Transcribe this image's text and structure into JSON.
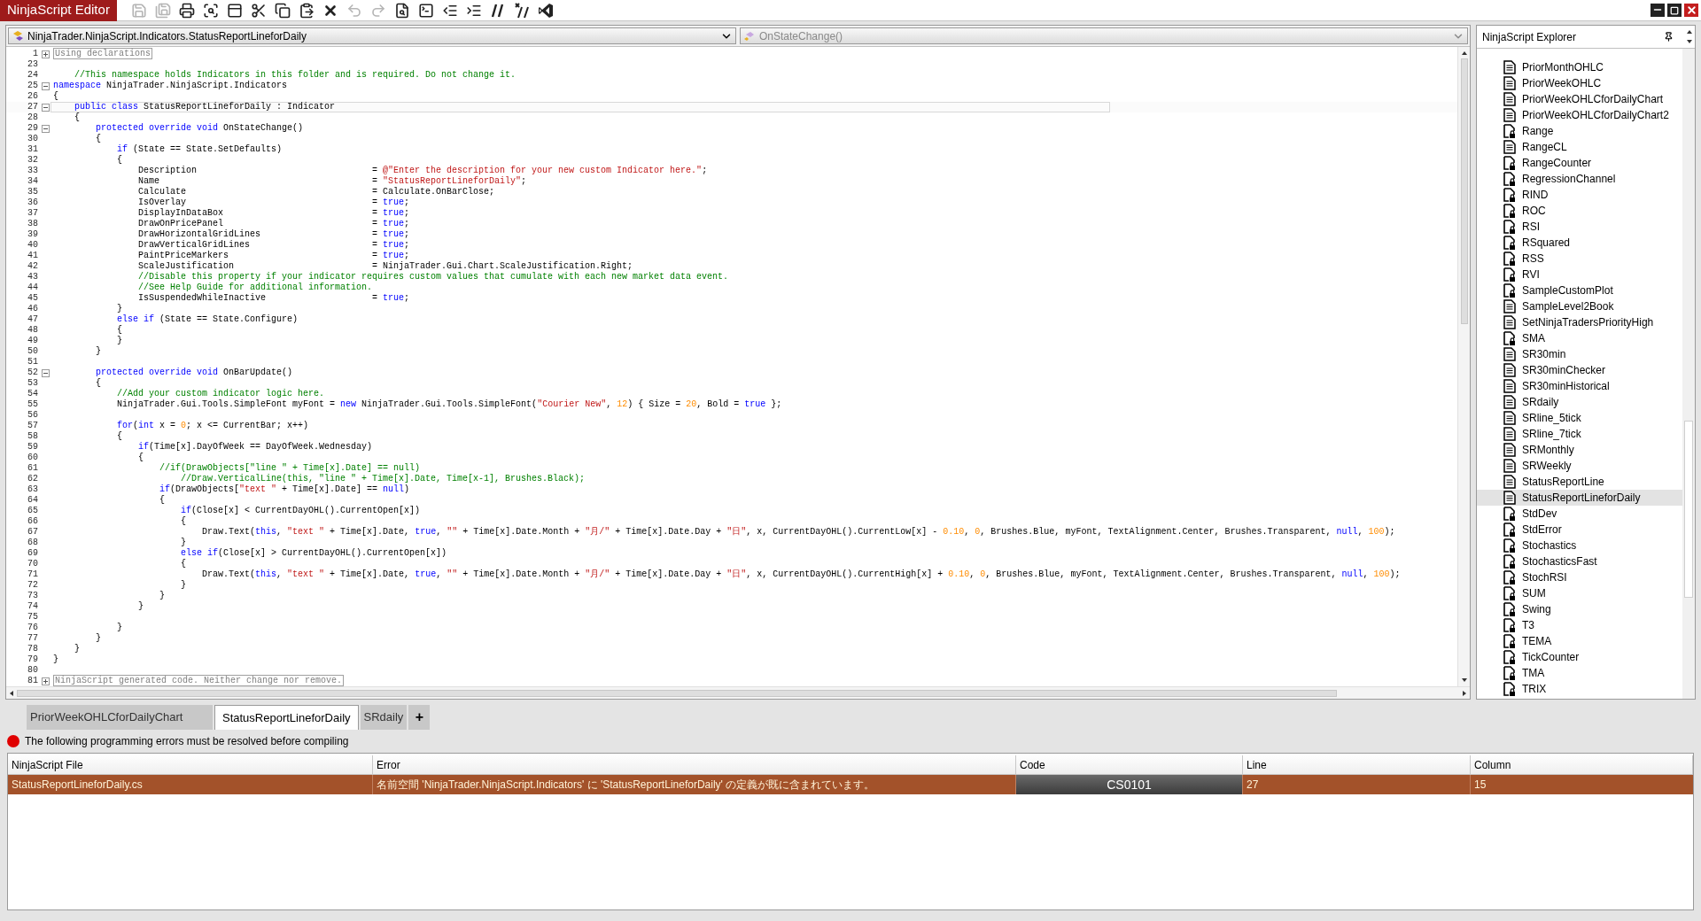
{
  "window": {
    "title": "NinjaScript Editor"
  },
  "toolbar": [
    {
      "kind": "save",
      "disabled": true
    },
    {
      "kind": "saveall",
      "disabled": true
    },
    {
      "kind": "print",
      "disabled": false
    },
    {
      "kind": "preview",
      "disabled": false
    },
    {
      "kind": "properties",
      "disabled": false
    },
    {
      "kind": "cut",
      "disabled": false
    },
    {
      "kind": "copy",
      "disabled": false
    },
    {
      "kind": "paste",
      "disabled": false
    },
    {
      "kind": "delete",
      "disabled": false
    },
    {
      "kind": "undo",
      "disabled": true
    },
    {
      "kind": "redo",
      "disabled": true
    },
    {
      "kind": "find",
      "disabled": false
    },
    {
      "kind": "compile",
      "disabled": false
    },
    {
      "kind": "outdent",
      "disabled": false
    },
    {
      "kind": "indent",
      "disabled": false
    },
    {
      "kind": "comment",
      "disabled": false
    },
    {
      "kind": "uncomment",
      "disabled": false
    },
    {
      "kind": "studio",
      "disabled": false
    }
  ],
  "editor": {
    "class_dropdown": "NinjaTrader.NinjaScript.Indicators.StatusReportLineforDaily",
    "member_dropdown": {
      "text": "OnStateChange()",
      "disabled": true
    },
    "lines": [
      {
        "num": "1",
        "collapsed": true,
        "current": false,
        "tokens": [
          {
            "kind": "region",
            "text": "Using declarations"
          }
        ]
      },
      {
        "num": "23",
        "current": false
      },
      {
        "num": "24",
        "current": false,
        "tokens": [
          {
            "kind": "comment",
            "text": "    //This namespace holds Indicators in this folder and is required. Do not change it."
          }
        ]
      },
      {
        "num": "25",
        "collapsed": false,
        "current": false,
        "tokens": [
          {
            "kind": "keyword",
            "text": "namespace"
          },
          {
            "kind": "plain",
            "text": " NinjaTrader.NinjaScript.Indicators"
          }
        ]
      },
      {
        "num": "26",
        "current": false,
        "tokens": [
          {
            "kind": "plain",
            "text": "{"
          }
        ]
      },
      {
        "num": "27",
        "collapsed": false,
        "current": true,
        "tokens": [
          {
            "kind": "keyword",
            "text": "    public class"
          },
          {
            "kind": "plain",
            "text": " StatusReportLineforDaily : Indicator"
          }
        ]
      },
      {
        "num": "28",
        "current": false,
        "tokens": [
          {
            "kind": "plain",
            "text": "    {"
          }
        ]
      },
      {
        "num": "29",
        "collapsed": false,
        "current": false,
        "tokens": [
          {
            "kind": "keyword",
            "text": "        protected override void"
          },
          {
            "kind": "plain",
            "text": " OnStateChange()"
          }
        ]
      },
      {
        "num": "30",
        "current": false,
        "tokens": [
          {
            "kind": "plain",
            "text": "        {"
          }
        ]
      },
      {
        "num": "31",
        "current": false,
        "tokens": [
          {
            "kind": "keyword",
            "text": "            if"
          },
          {
            "kind": "plain",
            "text": " (State == State.SetDefaults)"
          }
        ]
      },
      {
        "num": "32",
        "current": false,
        "tokens": [
          {
            "kind": "plain",
            "text": "            {"
          }
        ]
      },
      {
        "num": "33",
        "current": false,
        "tokens": [
          {
            "kind": "plain",
            "text": "                Description                                 = "
          },
          {
            "kind": "string",
            "text": "@\"Enter the description for your new custom Indicator here.\""
          },
          {
            "kind": "plain",
            "text": ";"
          }
        ]
      },
      {
        "num": "34",
        "current": false,
        "tokens": [
          {
            "kind": "plain",
            "text": "                Name                                        = "
          },
          {
            "kind": "string",
            "text": "\"StatusReportLineforDaily\""
          },
          {
            "kind": "plain",
            "text": ";"
          }
        ]
      },
      {
        "num": "35",
        "current": false,
        "tokens": [
          {
            "kind": "plain",
            "text": "                Calculate                                   = Calculate.OnBarClose;"
          }
        ]
      },
      {
        "num": "36",
        "current": false,
        "tokens": [
          {
            "kind": "plain",
            "text": "                IsOverlay                                   = "
          },
          {
            "kind": "keyword",
            "text": "true"
          },
          {
            "kind": "plain",
            "text": ";"
          }
        ]
      },
      {
        "num": "37",
        "current": false,
        "tokens": [
          {
            "kind": "plain",
            "text": "                DisplayInDataBox                            = "
          },
          {
            "kind": "keyword",
            "text": "true"
          },
          {
            "kind": "plain",
            "text": ";"
          }
        ]
      },
      {
        "num": "38",
        "current": false,
        "tokens": [
          {
            "kind": "plain",
            "text": "                DrawOnPricePanel                            = "
          },
          {
            "kind": "keyword",
            "text": "true"
          },
          {
            "kind": "plain",
            "text": ";"
          }
        ]
      },
      {
        "num": "39",
        "current": false,
        "tokens": [
          {
            "kind": "plain",
            "text": "                DrawHorizontalGridLines                     = "
          },
          {
            "kind": "keyword",
            "text": "true"
          },
          {
            "kind": "plain",
            "text": ";"
          }
        ]
      },
      {
        "num": "40",
        "current": false,
        "tokens": [
          {
            "kind": "plain",
            "text": "                DrawVerticalGridLines                       = "
          },
          {
            "kind": "keyword",
            "text": "true"
          },
          {
            "kind": "plain",
            "text": ";"
          }
        ]
      },
      {
        "num": "41",
        "current": false,
        "tokens": [
          {
            "kind": "plain",
            "text": "                PaintPriceMarkers                           = "
          },
          {
            "kind": "keyword",
            "text": "true"
          },
          {
            "kind": "plain",
            "text": ";"
          }
        ]
      },
      {
        "num": "42",
        "current": false,
        "tokens": [
          {
            "kind": "plain",
            "text": "                ScaleJustification                          = NinjaTrader.Gui.Chart.ScaleJustification.Right;"
          }
        ]
      },
      {
        "num": "43",
        "current": false,
        "tokens": [
          {
            "kind": "comment",
            "text": "                //Disable this property if your indicator requires custom values that cumulate with each new market data event."
          }
        ]
      },
      {
        "num": "44",
        "current": false,
        "tokens": [
          {
            "kind": "comment",
            "text": "                //See Help Guide for additional information."
          }
        ]
      },
      {
        "num": "45",
        "current": false,
        "tokens": [
          {
            "kind": "plain",
            "text": "                IsSuspendedWhileInactive                    = "
          },
          {
            "kind": "keyword",
            "text": "true"
          },
          {
            "kind": "plain",
            "text": ";"
          }
        ]
      },
      {
        "num": "46",
        "current": false,
        "tokens": [
          {
            "kind": "plain",
            "text": "            }"
          }
        ]
      },
      {
        "num": "47",
        "current": false,
        "tokens": [
          {
            "kind": "keyword",
            "text": "            else if"
          },
          {
            "kind": "plain",
            "text": " (State == State.Configure)"
          }
        ]
      },
      {
        "num": "48",
        "current": false,
        "tokens": [
          {
            "kind": "plain",
            "text": "            {"
          }
        ]
      },
      {
        "num": "49",
        "current": false,
        "tokens": [
          {
            "kind": "plain",
            "text": "            }"
          }
        ]
      },
      {
        "num": "50",
        "current": false,
        "tokens": [
          {
            "kind": "plain",
            "text": "        }"
          }
        ]
      },
      {
        "num": "51",
        "current": false
      },
      {
        "num": "52",
        "collapsed": false,
        "current": false,
        "tokens": [
          {
            "kind": "keyword",
            "text": "        protected override void"
          },
          {
            "kind": "plain",
            "text": " OnBarUpdate()"
          }
        ]
      },
      {
        "num": "53",
        "current": false,
        "tokens": [
          {
            "kind": "plain",
            "text": "        {"
          }
        ]
      },
      {
        "num": "54",
        "current": false,
        "tokens": [
          {
            "kind": "comment",
            "text": "            //Add your custom indicator logic here."
          }
        ]
      },
      {
        "num": "55",
        "current": false,
        "tokens": [
          {
            "kind": "plain",
            "text": "            NinjaTrader.Gui.Tools.SimpleFont myFont = "
          },
          {
            "kind": "keyword",
            "text": "new"
          },
          {
            "kind": "plain",
            "text": " NinjaTrader.Gui.Tools.SimpleFont("
          },
          {
            "kind": "string",
            "text": "\"Courier New\""
          },
          {
            "kind": "plain",
            "text": ", "
          },
          {
            "kind": "number",
            "text": "12"
          },
          {
            "kind": "plain",
            "text": ") { Size = "
          },
          {
            "kind": "number",
            "text": "20"
          },
          {
            "kind": "plain",
            "text": ", Bold = "
          },
          {
            "kind": "keyword",
            "text": "true"
          },
          {
            "kind": "plain",
            "text": " };"
          }
        ]
      },
      {
        "num": "56",
        "current": false
      },
      {
        "num": "57",
        "current": false,
        "tokens": [
          {
            "kind": "keyword",
            "text": "            for"
          },
          {
            "kind": "plain",
            "text": "("
          },
          {
            "kind": "keyword",
            "text": "int"
          },
          {
            "kind": "plain",
            "text": " x = "
          },
          {
            "kind": "number",
            "text": "0"
          },
          {
            "kind": "plain",
            "text": "; x <= CurrentBar; x++)"
          }
        ]
      },
      {
        "num": "58",
        "current": false,
        "tokens": [
          {
            "kind": "plain",
            "text": "            {"
          }
        ]
      },
      {
        "num": "59",
        "current": false,
        "tokens": [
          {
            "kind": "keyword",
            "text": "                if"
          },
          {
            "kind": "plain",
            "text": "(Time[x].DayOfWeek == DayOfWeek.Wednesday)"
          }
        ]
      },
      {
        "num": "60",
        "current": false,
        "tokens": [
          {
            "kind": "plain",
            "text": "                {"
          }
        ]
      },
      {
        "num": "61",
        "current": false,
        "tokens": [
          {
            "kind": "comment",
            "text": "                    //if(DrawObjects[\"line \" + Time[x].Date] == null)"
          }
        ]
      },
      {
        "num": "62",
        "current": false,
        "tokens": [
          {
            "kind": "comment",
            "text": "                        //Draw.VerticalLine(this, \"line \" + Time[x].Date, Time[x-1], Brushes.Black);"
          }
        ]
      },
      {
        "num": "63",
        "current": false,
        "tokens": [
          {
            "kind": "keyword",
            "text": "                    if"
          },
          {
            "kind": "plain",
            "text": "(DrawObjects["
          },
          {
            "kind": "string",
            "text": "\"text \""
          },
          {
            "kind": "plain",
            "text": " + Time[x].Date] == "
          },
          {
            "kind": "keyword",
            "text": "null"
          },
          {
            "kind": "plain",
            "text": ")"
          }
        ]
      },
      {
        "num": "64",
        "current": false,
        "tokens": [
          {
            "kind": "plain",
            "text": "                    {"
          }
        ]
      },
      {
        "num": "65",
        "current": false,
        "tokens": [
          {
            "kind": "keyword",
            "text": "                        if"
          },
          {
            "kind": "plain",
            "text": "(Close[x] < CurrentDayOHL().CurrentOpen[x])"
          }
        ]
      },
      {
        "num": "66",
        "current": false,
        "tokens": [
          {
            "kind": "plain",
            "text": "                        {"
          }
        ]
      },
      {
        "num": "67",
        "current": false,
        "tokens": [
          {
            "kind": "plain",
            "text": "                            Draw.Text("
          },
          {
            "kind": "keyword",
            "text": "this"
          },
          {
            "kind": "plain",
            "text": ", "
          },
          {
            "kind": "string",
            "text": "\"text \""
          },
          {
            "kind": "plain",
            "text": " + Time[x].Date, "
          },
          {
            "kind": "keyword",
            "text": "true"
          },
          {
            "kind": "plain",
            "text": ", "
          },
          {
            "kind": "string",
            "text": "\"\""
          },
          {
            "kind": "plain",
            "text": " + Time[x].Date.Month + "
          },
          {
            "kind": "string",
            "text": "\"月/\""
          },
          {
            "kind": "plain",
            "text": " + Time[x].Date.Day + "
          },
          {
            "kind": "string",
            "text": "\"日\""
          },
          {
            "kind": "plain",
            "text": ", x, CurrentDayOHL().CurrentLow[x] - "
          },
          {
            "kind": "number",
            "text": "0.10"
          },
          {
            "kind": "plain",
            "text": ", "
          },
          {
            "kind": "number",
            "text": "0"
          },
          {
            "kind": "plain",
            "text": ", Brushes.Blue, myFont, TextAlignment.Center, Brushes.Transparent, "
          },
          {
            "kind": "keyword",
            "text": "null"
          },
          {
            "kind": "plain",
            "text": ", "
          },
          {
            "kind": "number",
            "text": "100"
          },
          {
            "kind": "plain",
            "text": ");"
          }
        ]
      },
      {
        "num": "68",
        "current": false,
        "tokens": [
          {
            "kind": "plain",
            "text": "                        }"
          }
        ]
      },
      {
        "num": "69",
        "current": false,
        "tokens": [
          {
            "kind": "keyword",
            "text": "                        else if"
          },
          {
            "kind": "plain",
            "text": "(Close[x] > CurrentDayOHL().CurrentOpen[x])"
          }
        ]
      },
      {
        "num": "70",
        "current": false,
        "tokens": [
          {
            "kind": "plain",
            "text": "                        {"
          }
        ]
      },
      {
        "num": "71",
        "current": false,
        "tokens": [
          {
            "kind": "plain",
            "text": "                            Draw.Text("
          },
          {
            "kind": "keyword",
            "text": "this"
          },
          {
            "kind": "plain",
            "text": ", "
          },
          {
            "kind": "string",
            "text": "\"text \""
          },
          {
            "kind": "plain",
            "text": " + Time[x].Date, "
          },
          {
            "kind": "keyword",
            "text": "true"
          },
          {
            "kind": "plain",
            "text": ", "
          },
          {
            "kind": "string",
            "text": "\"\""
          },
          {
            "kind": "plain",
            "text": " + Time[x].Date.Month + "
          },
          {
            "kind": "string",
            "text": "\"月/\""
          },
          {
            "kind": "plain",
            "text": " + Time[x].Date.Day + "
          },
          {
            "kind": "string",
            "text": "\"日\""
          },
          {
            "kind": "plain",
            "text": ", x, CurrentDayOHL().CurrentHigh[x] + "
          },
          {
            "kind": "number",
            "text": "0.10"
          },
          {
            "kind": "plain",
            "text": ", "
          },
          {
            "kind": "number",
            "text": "0"
          },
          {
            "kind": "plain",
            "text": ", Brushes.Blue, myFont, TextAlignment.Center, Brushes.Transparent, "
          },
          {
            "kind": "keyword",
            "text": "null"
          },
          {
            "kind": "plain",
            "text": ", "
          },
          {
            "kind": "number",
            "text": "100"
          },
          {
            "kind": "plain",
            "text": ");"
          }
        ]
      },
      {
        "num": "72",
        "current": false,
        "tokens": [
          {
            "kind": "plain",
            "text": "                        }"
          }
        ]
      },
      {
        "num": "73",
        "current": false,
        "tokens": [
          {
            "kind": "plain",
            "text": "                    }"
          }
        ]
      },
      {
        "num": "74",
        "current": false,
        "tokens": [
          {
            "kind": "plain",
            "text": "                }"
          }
        ]
      },
      {
        "num": "75",
        "current": false
      },
      {
        "num": "76",
        "current": false,
        "tokens": [
          {
            "kind": "plain",
            "text": "            }"
          }
        ]
      },
      {
        "num": "77",
        "current": false,
        "tokens": [
          {
            "kind": "plain",
            "text": "        }"
          }
        ]
      },
      {
        "num": "78",
        "current": false,
        "tokens": [
          {
            "kind": "plain",
            "text": "    }"
          }
        ]
      },
      {
        "num": "79",
        "current": false,
        "tokens": [
          {
            "kind": "plain",
            "text": "}"
          }
        ]
      },
      {
        "num": "80",
        "current": false
      },
      {
        "num": "81",
        "collapsed": true,
        "current": false,
        "tokens": [
          {
            "kind": "region",
            "text": "NinjaScript generated code. Neither change nor remove."
          }
        ]
      }
    ]
  },
  "explorer": {
    "title": "NinjaScript Explorer",
    "items": [
      {
        "text": "PriorMonthOHLC",
        "kind": "file",
        "selected": false
      },
      {
        "text": "PriorWeekOHLC",
        "kind": "file",
        "selected": false
      },
      {
        "text": "PriorWeekOHLCforDailyChart",
        "kind": "file",
        "selected": false
      },
      {
        "text": "PriorWeekOHLCforDailyChart2",
        "kind": "file",
        "selected": false
      },
      {
        "text": "Range",
        "kind": "locked",
        "selected": false
      },
      {
        "text": "RangeCL",
        "kind": "file",
        "selected": false
      },
      {
        "text": "RangeCounter",
        "kind": "locked",
        "selected": false
      },
      {
        "text": "RegressionChannel",
        "kind": "locked",
        "selected": false
      },
      {
        "text": "RIND",
        "kind": "locked",
        "selected": false
      },
      {
        "text": "ROC",
        "kind": "locked",
        "selected": false
      },
      {
        "text": "RSI",
        "kind": "locked",
        "selected": false
      },
      {
        "text": "RSquared",
        "kind": "locked",
        "selected": false
      },
      {
        "text": "RSS",
        "kind": "locked",
        "selected": false
      },
      {
        "text": "RVI",
        "kind": "locked",
        "selected": false
      },
      {
        "text": "SampleCustomPlot",
        "kind": "locked",
        "selected": false
      },
      {
        "text": "SampleLevel2Book",
        "kind": "file",
        "selected": false
      },
      {
        "text": "SetNinjaTradersPriorityHigh",
        "kind": "file",
        "selected": false
      },
      {
        "text": "SMA",
        "kind": "locked",
        "selected": false
      },
      {
        "text": "SR30min",
        "kind": "file",
        "selected": false
      },
      {
        "text": "SR30minChecker",
        "kind": "file",
        "selected": false
      },
      {
        "text": "SR30minHistorical",
        "kind": "file",
        "selected": false
      },
      {
        "text": "SRdaily",
        "kind": "file",
        "selected": false
      },
      {
        "text": "SRline_5tick",
        "kind": "file",
        "selected": false
      },
      {
        "text": "SRline_7tick",
        "kind": "file",
        "selected": false
      },
      {
        "text": "SRMonthly",
        "kind": "file",
        "selected": false
      },
      {
        "text": "SRWeekly",
        "kind": "file",
        "selected": false
      },
      {
        "text": "StatusReportLine",
        "kind": "file",
        "selected": false
      },
      {
        "text": "StatusReportLineforDaily",
        "kind": "file",
        "selected": true
      },
      {
        "text": "StdDev",
        "kind": "locked",
        "selected": false
      },
      {
        "text": "StdError",
        "kind": "locked",
        "selected": false
      },
      {
        "text": "Stochastics",
        "kind": "locked",
        "selected": false
      },
      {
        "text": "StochasticsFast",
        "kind": "locked",
        "selected": false
      },
      {
        "text": "StochRSI",
        "kind": "locked",
        "selected": false
      },
      {
        "text": "SUM",
        "kind": "locked",
        "selected": false
      },
      {
        "text": "Swing",
        "kind": "locked",
        "selected": false
      },
      {
        "text": "T3",
        "kind": "locked",
        "selected": false
      },
      {
        "text": "TEMA",
        "kind": "locked",
        "selected": false
      },
      {
        "text": "TickCounter",
        "kind": "locked",
        "selected": false
      },
      {
        "text": "TMA",
        "kind": "locked",
        "selected": false
      },
      {
        "text": "TRIX",
        "kind": "locked",
        "selected": false
      }
    ]
  },
  "tabs": [
    {
      "label": "PriorWeekOHLCforDailyChart",
      "selected": false
    },
    {
      "label": "StatusReportLineforDaily",
      "selected": true
    },
    {
      "label": "SRdaily",
      "selected": false
    }
  ],
  "add_tab": "+",
  "errors": {
    "message": "The following programming errors must be resolved before compiling",
    "columns": [
      "NinjaScript File",
      "Error",
      "Code",
      "Line",
      "Column"
    ],
    "rows": [
      {
        "file": "StatusReportLineforDaily.cs",
        "error": "名前空間 'NinjaTrader.NinjaScript.Indicators' に 'StatusReportLineforDaily' の定義が既に含まれています。",
        "code": "CS0101",
        "line": "27",
        "column": "15"
      }
    ]
  }
}
